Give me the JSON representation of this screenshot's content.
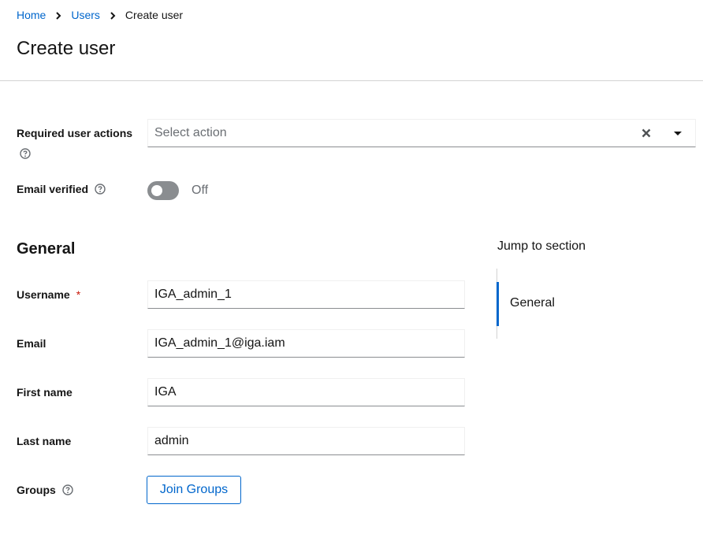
{
  "breadcrumb": {
    "items": [
      "Home",
      "Users"
    ],
    "current": "Create user"
  },
  "page": {
    "title": "Create user"
  },
  "required_actions": {
    "label": "Required user actions",
    "placeholder": "Select action"
  },
  "email_verified": {
    "label": "Email verified",
    "state": "Off"
  },
  "general": {
    "title": "General",
    "username": {
      "label": "Username",
      "required_mark": "*",
      "value": "IGA_admin_1"
    },
    "email": {
      "label": "Email",
      "value": "IGA_admin_1@iga.iam"
    },
    "first_name": {
      "label": "First name",
      "value": "IGA"
    },
    "last_name": {
      "label": "Last name",
      "value": "admin"
    },
    "groups": {
      "label": "Groups",
      "button_label": "Join Groups"
    }
  },
  "jump_to_section": {
    "title": "Jump to section",
    "items": [
      "General"
    ]
  },
  "colors": {
    "link": "#0066cc",
    "required": "#c9190b",
    "switch_off": "#8a8d90",
    "text": "#151515",
    "muted": "#6a6e73"
  },
  "icons": {
    "help": "help-circle-icon",
    "breadcrumb_separator": "chevron-right-icon",
    "clear": "times-icon",
    "dropdown": "caret-down-icon"
  }
}
